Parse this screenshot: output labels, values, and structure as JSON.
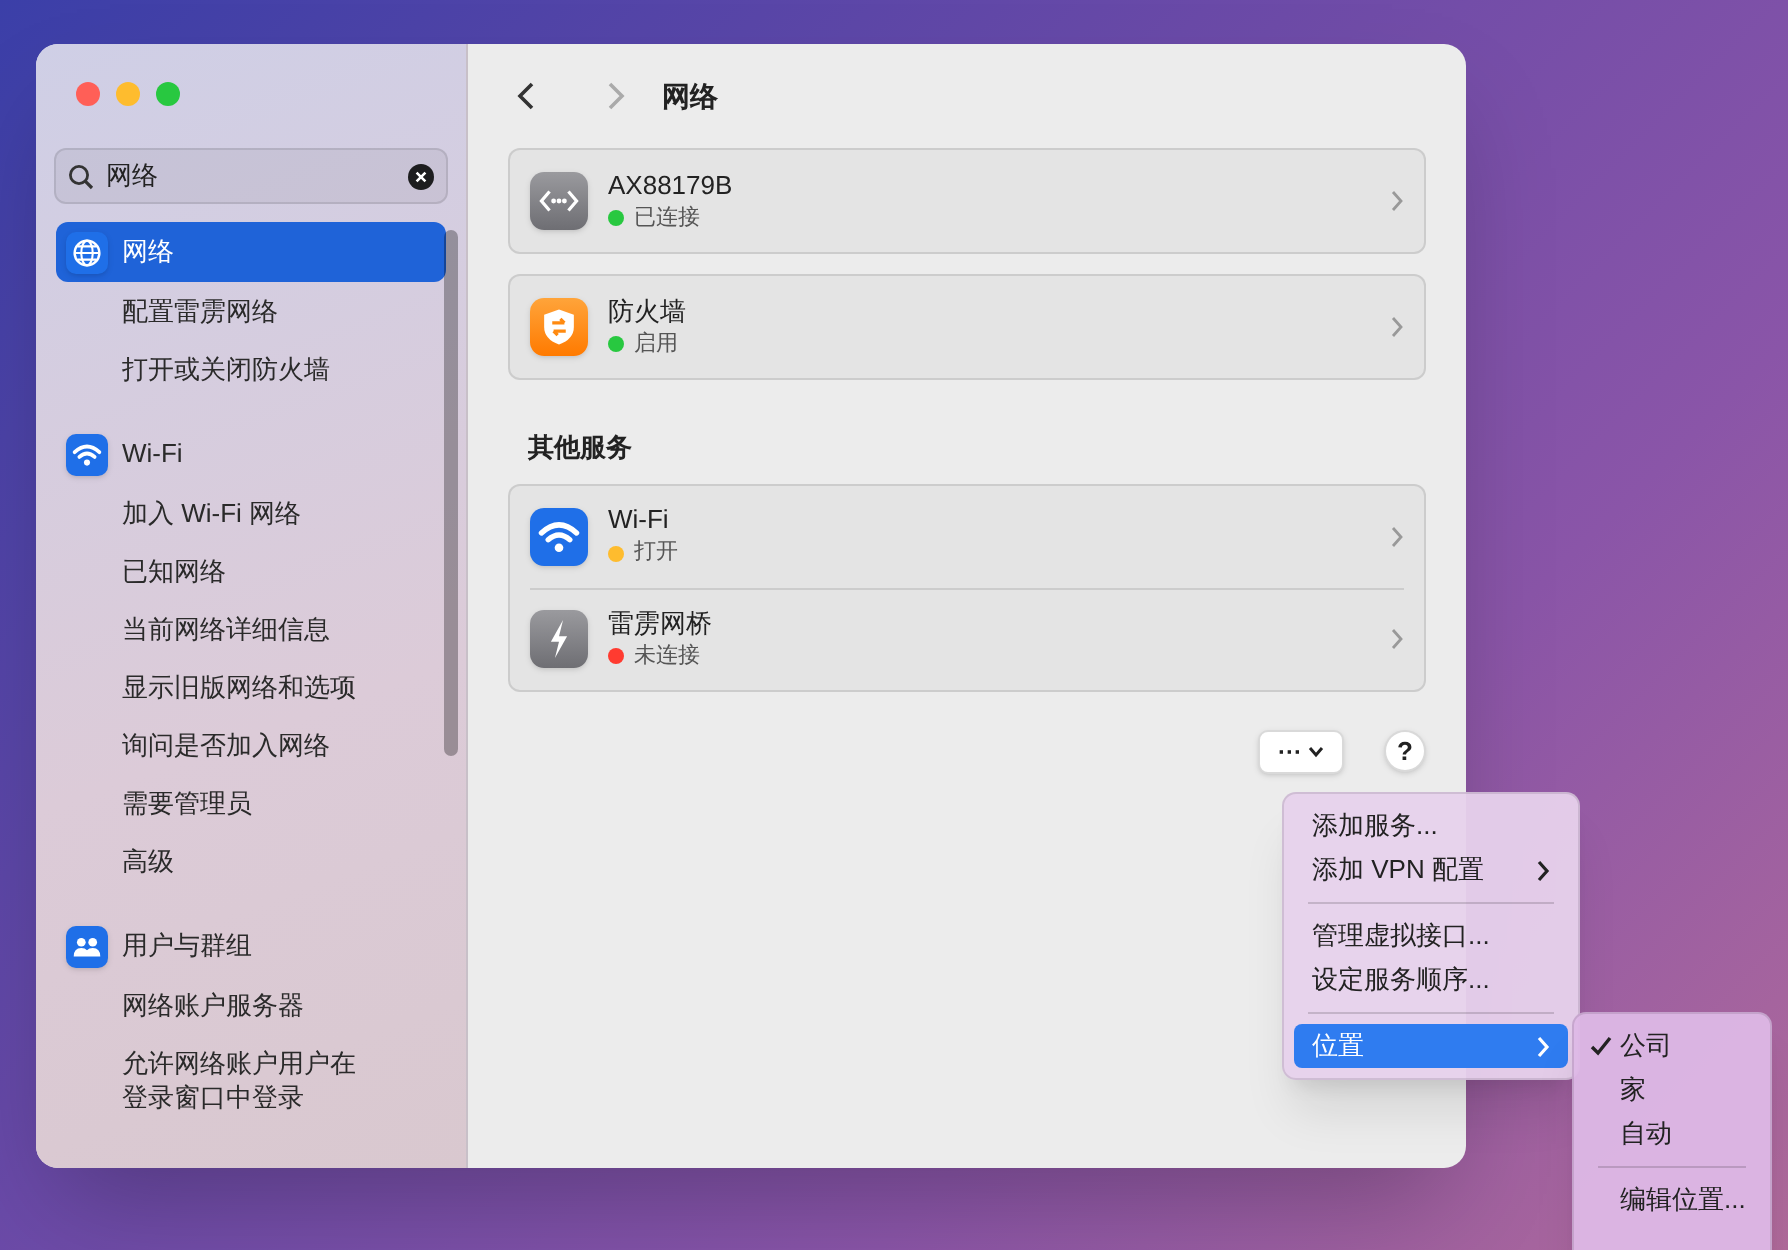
{
  "sidebar": {
    "search": {
      "value": "网络"
    },
    "sections": [
      {
        "title": "网络",
        "kind": "globe",
        "selected": true,
        "items": [
          {
            "label": "配置雷雳网络",
            "selected": false
          },
          {
            "label": "打开或关闭防火墙",
            "selected": false
          }
        ]
      },
      {
        "title": "Wi-Fi",
        "kind": "wifi",
        "selected": false,
        "items": [
          {
            "label": "加入 Wi-Fi 网络",
            "selected": false
          },
          {
            "label": "已知网络",
            "selected": false
          },
          {
            "label": "当前网络详细信息",
            "selected": false
          },
          {
            "label": "显示旧版网络和选项",
            "selected": false
          },
          {
            "label": "询问是否加入网络",
            "selected": false
          },
          {
            "label": "需要管理员",
            "selected": false
          },
          {
            "label": "高级",
            "selected": false
          }
        ]
      },
      {
        "title": "用户与群组",
        "kind": "users",
        "selected": false,
        "items": [
          {
            "label": "网络账户服务器",
            "selected": false
          },
          {
            "label": "允许网络账户用户在登录窗口中登录",
            "selected": false
          }
        ]
      }
    ]
  },
  "main": {
    "title": "网络",
    "groups": [
      {
        "services": [
          {
            "name": "AX88179B",
            "kind": "ethernet",
            "status": "已连接",
            "color": "#28c840"
          }
        ]
      },
      {
        "services": [
          {
            "name": "防火墙",
            "kind": "firewall",
            "status": "启用",
            "color": "#28c840"
          }
        ]
      },
      {
        "heading": "其他服务",
        "services": [
          {
            "name": "Wi-Fi",
            "kind": "wifi",
            "status": "打开",
            "color": "#febc2e"
          },
          {
            "name": "雷雳网桥",
            "kind": "thunderbolt",
            "status": "未连接",
            "color": "#ff3b30"
          }
        ]
      }
    ],
    "actions_button": "···",
    "help_button": "?"
  },
  "menu": {
    "items": [
      {
        "kind": "item",
        "label": "添加服务...",
        "selected": false
      },
      {
        "kind": "submenu",
        "label": "添加 VPN 配置",
        "selected": false
      },
      {
        "kind": "separator"
      },
      {
        "kind": "item",
        "label": "管理虚拟接口...",
        "selected": false
      },
      {
        "kind": "item",
        "label": "设定服务顺序...",
        "selected": false
      },
      {
        "kind": "separator"
      },
      {
        "kind": "submenu",
        "label": "位置",
        "selected": true
      }
    ],
    "submenu": [
      {
        "kind": "item",
        "label": "公司",
        "checked": true
      },
      {
        "kind": "item",
        "label": "家",
        "checked": false
      },
      {
        "kind": "item",
        "label": "自动",
        "checked": false
      },
      {
        "kind": "separator"
      },
      {
        "kind": "item",
        "label": "编辑位置...",
        "checked": false
      }
    ]
  }
}
